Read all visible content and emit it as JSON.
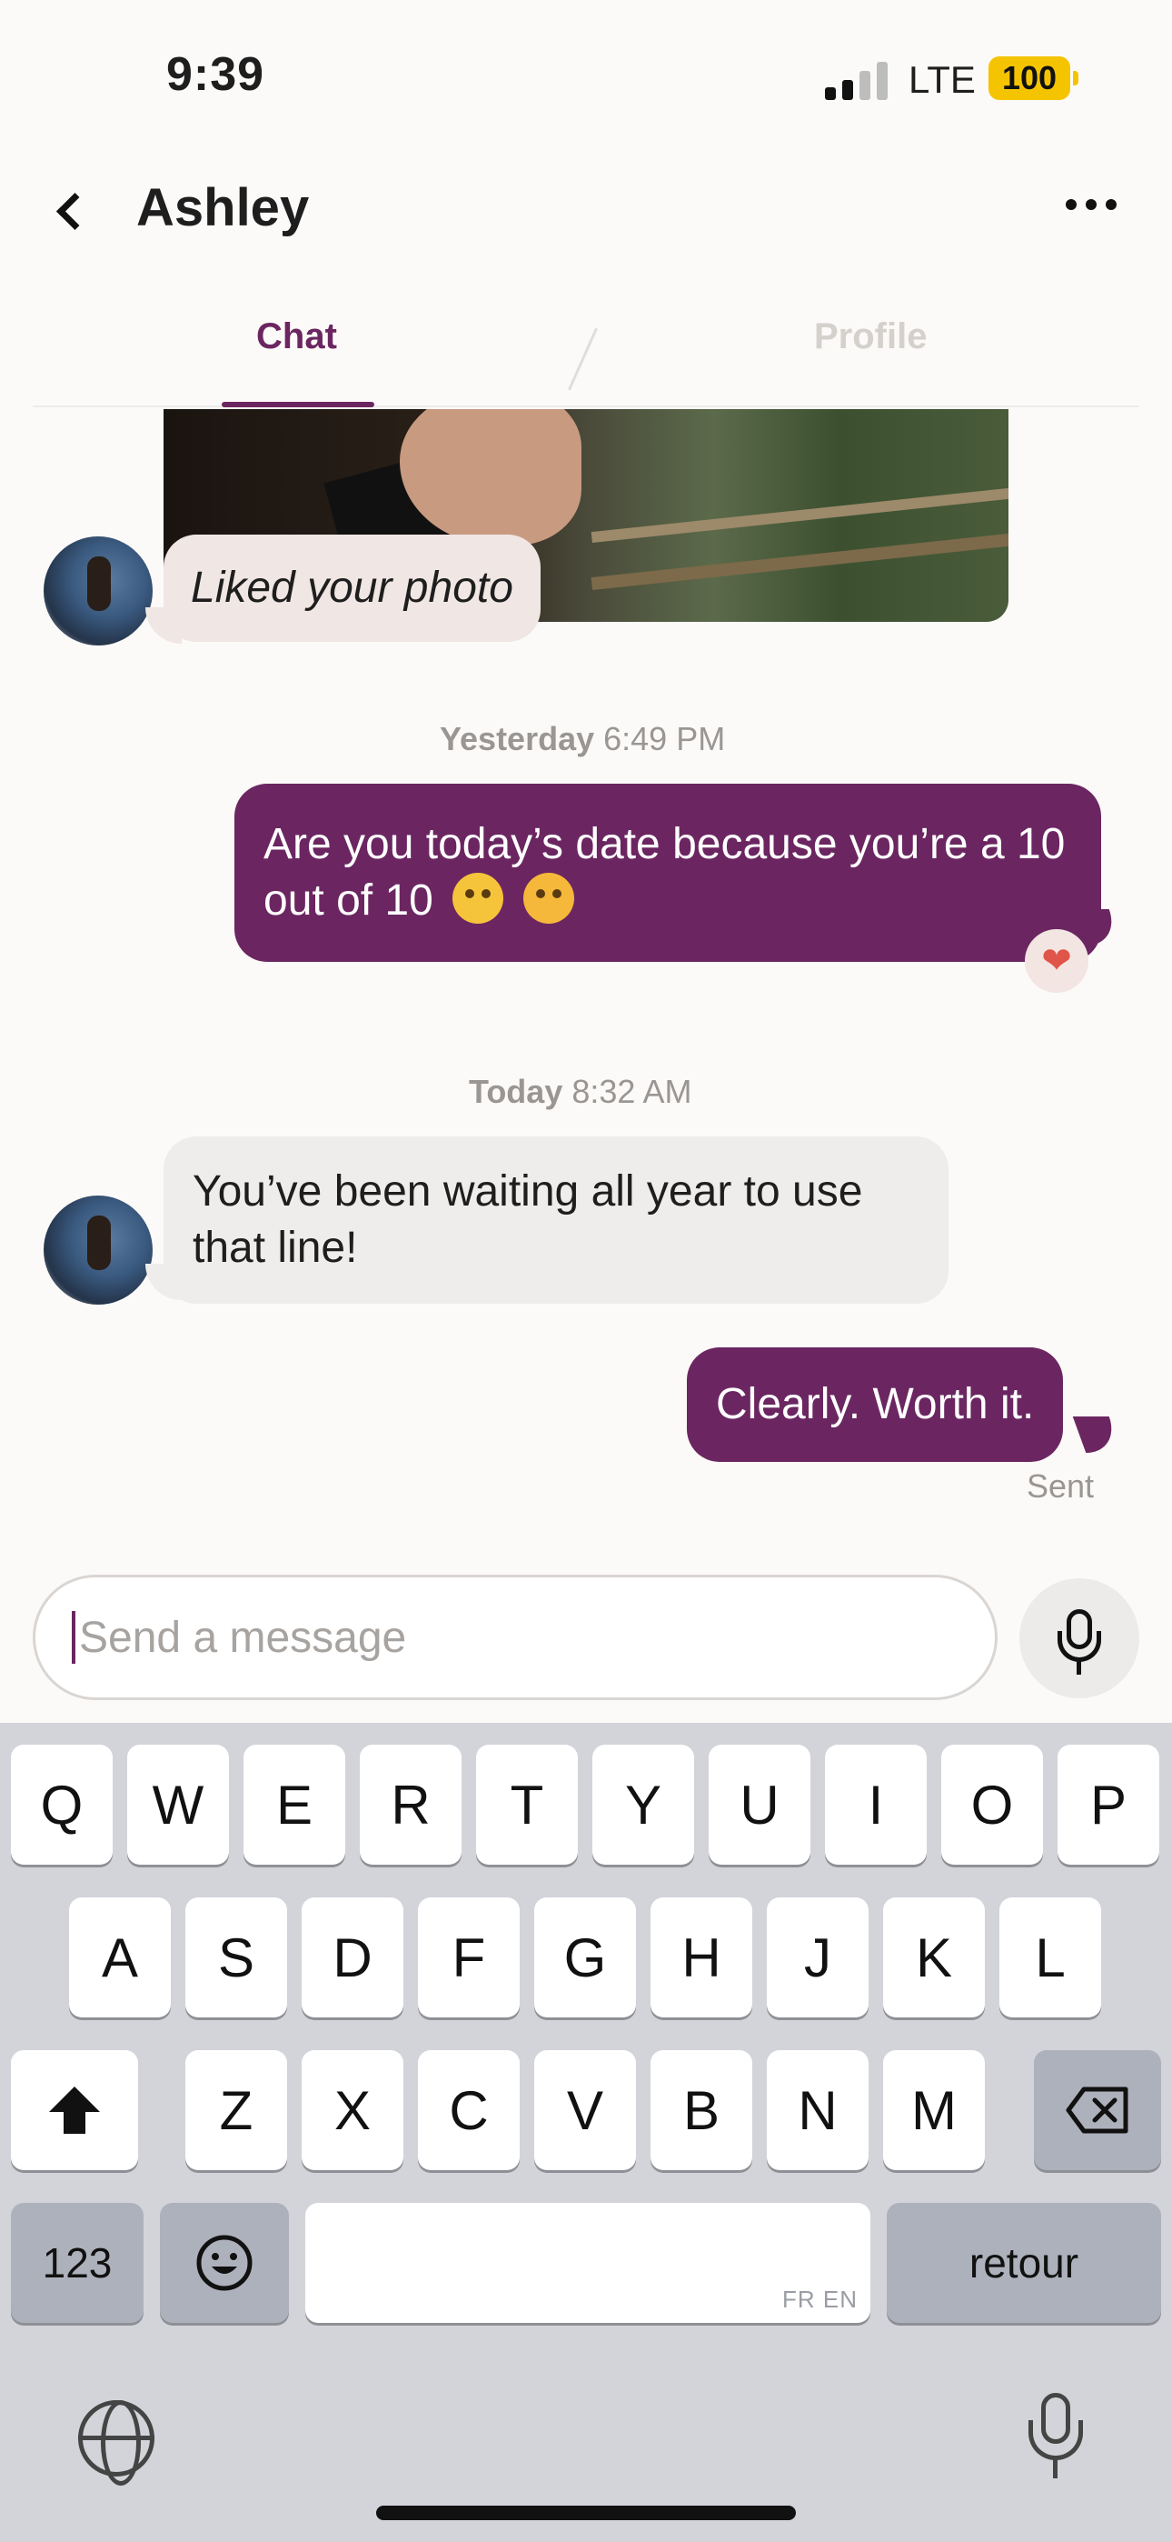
{
  "status_bar": {
    "time": "9:39",
    "network": "LTE",
    "battery": "100"
  },
  "header": {
    "title": "Ashley"
  },
  "tabs": [
    {
      "label": "Chat"
    },
    {
      "label": "Profile"
    }
  ],
  "messages": {
    "liked_photo": "Liked your photo",
    "timestamp1": {
      "day": "Yesterday",
      "time": "6:49 PM"
    },
    "out1": "Are you today’s date because you’re a 10 out of 10",
    "timestamp2": {
      "day": "Today",
      "time": "8:32 AM"
    },
    "in1": "You’ve been waiting all year to use that line!",
    "out2": "Clearly. Worth it.",
    "out2_status": "Sent"
  },
  "composer": {
    "placeholder": "Send a message"
  },
  "keyboard": {
    "row1": [
      "Q",
      "W",
      "E",
      "R",
      "T",
      "Y",
      "U",
      "I",
      "O",
      "P"
    ],
    "row2": [
      "A",
      "S",
      "D",
      "F",
      "G",
      "H",
      "J",
      "K",
      "L"
    ],
    "row3": [
      "Z",
      "X",
      "C",
      "V",
      "B",
      "N",
      "M"
    ],
    "numbers_key": "123",
    "return_key": "retour",
    "language_hint": "FR EN"
  },
  "colors": {
    "accent": "#6b2661",
    "incoming_bubble": "#efedeb",
    "heart": "#e0554a"
  }
}
